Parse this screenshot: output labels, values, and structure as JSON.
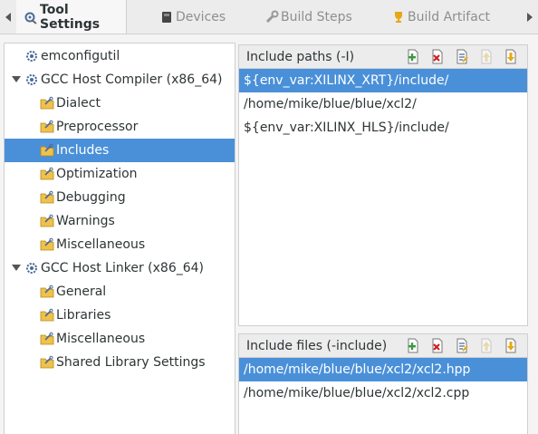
{
  "tabs": [
    {
      "label": "Tool Settings",
      "icon": "tool-settings-icon",
      "active": true
    },
    {
      "label": "Devices",
      "icon": "devices-icon",
      "active": false
    },
    {
      "label": "Build Steps",
      "icon": "build-steps-icon",
      "active": false
    },
    {
      "label": "Build Artifact",
      "icon": "build-artifact-icon",
      "active": false
    }
  ],
  "tree": {
    "items": [
      {
        "label": "emconfigutil",
        "icon": "gear-icon",
        "level": 0,
        "expander": "none",
        "selected": false
      },
      {
        "label": "GCC Host Compiler (x86_64)",
        "icon": "gear-icon",
        "level": 0,
        "expander": "expanded",
        "selected": false
      },
      {
        "label": "Dialect",
        "icon": "folder-icon",
        "level": 1,
        "expander": "none",
        "selected": false
      },
      {
        "label": "Preprocessor",
        "icon": "folder-icon",
        "level": 1,
        "expander": "none",
        "selected": false
      },
      {
        "label": "Includes",
        "icon": "folder-icon",
        "level": 1,
        "expander": "none",
        "selected": true
      },
      {
        "label": "Optimization",
        "icon": "folder-icon",
        "level": 1,
        "expander": "none",
        "selected": false
      },
      {
        "label": "Debugging",
        "icon": "folder-icon",
        "level": 1,
        "expander": "none",
        "selected": false
      },
      {
        "label": "Warnings",
        "icon": "folder-icon",
        "level": 1,
        "expander": "none",
        "selected": false
      },
      {
        "label": "Miscellaneous",
        "icon": "folder-icon",
        "level": 1,
        "expander": "none",
        "selected": false
      },
      {
        "label": "GCC Host Linker (x86_64)",
        "icon": "gear-icon",
        "level": 0,
        "expander": "expanded",
        "selected": false
      },
      {
        "label": "General",
        "icon": "folder-icon",
        "level": 1,
        "expander": "none",
        "selected": false
      },
      {
        "label": "Libraries",
        "icon": "folder-icon",
        "level": 1,
        "expander": "none",
        "selected": false
      },
      {
        "label": "Miscellaneous",
        "icon": "folder-icon",
        "level": 1,
        "expander": "none",
        "selected": false
      },
      {
        "label": "Shared Library Settings",
        "icon": "folder-icon",
        "level": 1,
        "expander": "none",
        "selected": false
      }
    ]
  },
  "include_paths": {
    "title": "Include paths (-I)",
    "toolbar": [
      {
        "icon": "add-icon",
        "enabled": true
      },
      {
        "icon": "delete-icon",
        "enabled": true
      },
      {
        "icon": "edit-icon",
        "enabled": true
      },
      {
        "icon": "move-up-icon",
        "enabled": false
      },
      {
        "icon": "move-down-icon",
        "enabled": true
      }
    ],
    "items": [
      {
        "text": "${env_var:XILINX_XRT}/include/",
        "selected": true
      },
      {
        "text": "/home/mike/blue/blue/xcl2/",
        "selected": false
      },
      {
        "text": "${env_var:XILINX_HLS}/include/",
        "selected": false
      }
    ]
  },
  "include_files": {
    "title": "Include files (-include)",
    "toolbar": [
      {
        "icon": "add-icon",
        "enabled": true
      },
      {
        "icon": "delete-icon",
        "enabled": true
      },
      {
        "icon": "edit-icon",
        "enabled": true
      },
      {
        "icon": "move-up-icon",
        "enabled": false
      },
      {
        "icon": "move-down-icon",
        "enabled": true
      }
    ],
    "items": [
      {
        "text": "/home/mike/blue/blue/xcl2/xcl2.hpp",
        "selected": true
      },
      {
        "text": "/home/mike/blue/blue/xcl2/xcl2.cpp",
        "selected": false
      }
    ]
  },
  "colors": {
    "selection": "#4a90d9",
    "accent_gold": "#e6a817",
    "add_green": "#3a9a3a",
    "delete_red": "#cc2222"
  }
}
